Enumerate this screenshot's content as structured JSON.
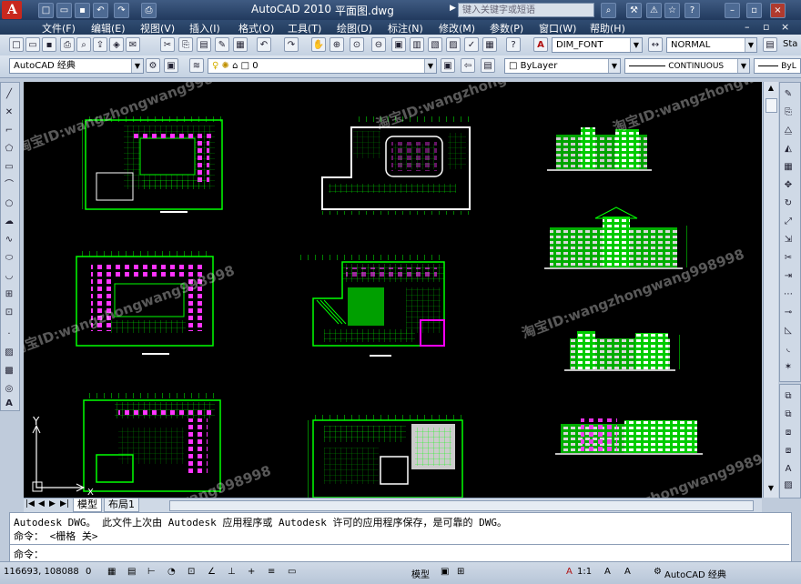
{
  "titlebar": {
    "app_title": "AutoCAD 2010",
    "file_name": "平面图.dwg",
    "search_placeholder": "键入关键字或短语",
    "logo_letter": "A"
  },
  "menus": [
    "文件(F)",
    "编辑(E)",
    "视图(V)",
    "插入(I)",
    "格式(O)",
    "工具(T)",
    "绘图(D)",
    "标注(N)",
    "修改(M)",
    "参数(P)",
    "窗口(W)",
    "帮助(H)"
  ],
  "toolbar2": {
    "dimstyle": "DIM_FONT",
    "tablestyle": "NORMAL",
    "textstyle": "Sta"
  },
  "toolbar3": {
    "workspace": "AutoCAD 经典",
    "layer": "0",
    "color": "ByLayer",
    "linetype": "CONTINUOUS",
    "lineweight": "ByL"
  },
  "watermarks": [
    "淘宝ID:wangzhongwang998998",
    "淘宝ID:wangzhongwang998998",
    "淘宝ID:wangzhongwang998998",
    "淘宝ID:wangzhongwang998998",
    "淘宝ID:wangzhongwang998998",
    "淘宝ID:wangzhongwang998998",
    "淘宝ID:wangzhongwang998998"
  ],
  "ucs": {
    "y": "Y",
    "x": "X"
  },
  "tabs": [
    "模型",
    "布局1"
  ],
  "command": {
    "line1": "Autodesk DWG。  此文件上次由 Autodesk 应用程序或 Autodesk 许可的应用程序保存，是可靠的 DWG。",
    "line2": "命令： <栅格 关>",
    "prompt": "命令："
  },
  "status": {
    "coords": "116693, 108088",
    "coord_z": "0",
    "model": "模型",
    "scale": "1:1",
    "workspace": "AutoCAD 经典"
  },
  "colors": {
    "canvas": "#000000",
    "drawing_green": "#00ff00",
    "drawing_magenta": "#ff00ff"
  }
}
